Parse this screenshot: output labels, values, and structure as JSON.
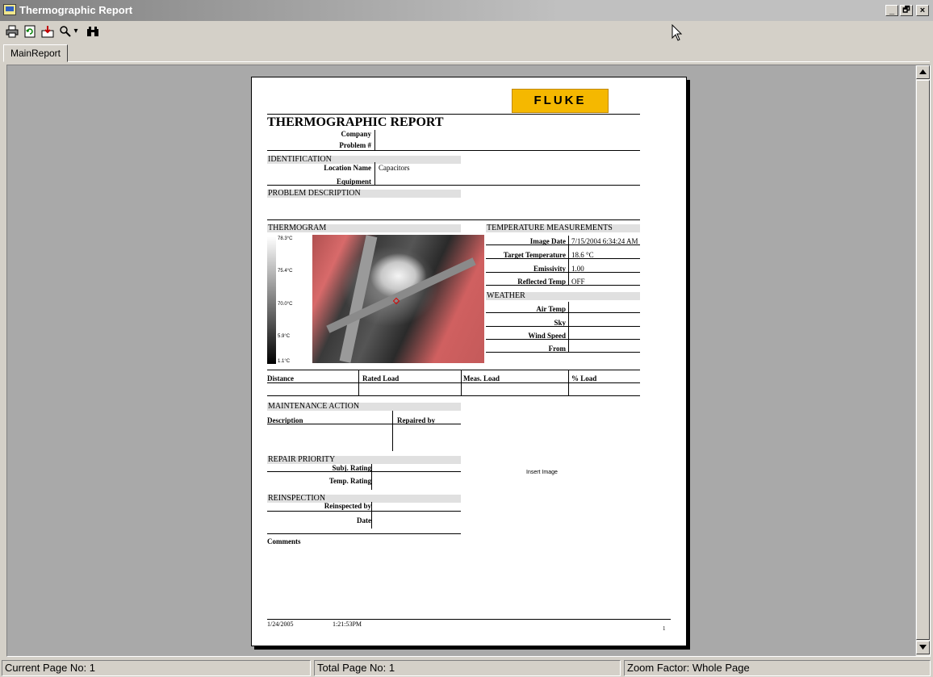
{
  "window": {
    "title": "Thermographic Report",
    "minimize_glyph": "_",
    "restore_glyph": "🗗",
    "close_glyph": "×"
  },
  "toolbar": {
    "print_icon": "print-icon",
    "refresh_icon": "refresh-icon",
    "export_icon": "export-icon",
    "zoom_icon": "zoom-icon",
    "zoom_dropdown_glyph": "▾",
    "find_icon": "binoculars-icon"
  },
  "tabs": [
    {
      "label": "MainReport"
    }
  ],
  "report": {
    "logo_text": "FLUKE",
    "title": "THERMOGRAPHIC REPORT",
    "company_label": "Company",
    "problem_label": "Problem #",
    "identification": {
      "heading": "IDENTIFICATION",
      "location_label": "Location Name",
      "location_value": "Capacitors",
      "equipment_label": "Equipment"
    },
    "problem_description_heading": "PROBLEM DESCRIPTION",
    "thermogram": {
      "heading": "THERMOGRAM",
      "scale_labels": [
        "78.3°C",
        "75.4°C",
        "70.0°C",
        "5.9°C",
        "1.1°C"
      ]
    },
    "temperature_measurements": {
      "heading": "TEMPERATURE MEASUREMENTS",
      "image_date_label": "Image Date",
      "image_date_value": "7/15/2004 6:34:24 AM",
      "target_temp_label": "Target Temperature",
      "target_temp_value": "18.6 °C",
      "emissivity_label": "Emissivity",
      "emissivity_value": "1.00",
      "reflected_temp_label": "Reflected Temp",
      "reflected_temp_value": "OFF"
    },
    "weather": {
      "heading": "WEATHER",
      "air_temp_label": "Air Temp",
      "sky_label": "Sky",
      "wind_speed_label": "Wind Speed",
      "from_label": "From"
    },
    "load_table": {
      "distance": "Distance",
      "rated_load": "Rated Load",
      "meas_load": "Meas. Load",
      "pct_load": "% Load"
    },
    "maintenance": {
      "heading": "MAINTENANCE ACTION",
      "description_label": "Description",
      "repaired_by_label": "Repaired by"
    },
    "repair_priority": {
      "heading": "REPAIR PRIORITY",
      "subj_rating_label": "Subj. Rating",
      "temp_rating_label": "Temp. Rating"
    },
    "insert_image_text": "Insert Image",
    "reinspection": {
      "heading": "REINSPECTION",
      "reinspected_by_label": "Reinspected by",
      "date_label": "Date"
    },
    "comments_label": "Comments",
    "footer": {
      "date": "1/24/2005",
      "time": "1:21:53PM",
      "page": "1"
    }
  },
  "status": {
    "current_page": "Current Page No: 1",
    "total_page": "Total Page No: 1",
    "zoom": "Zoom Factor: Whole Page"
  }
}
